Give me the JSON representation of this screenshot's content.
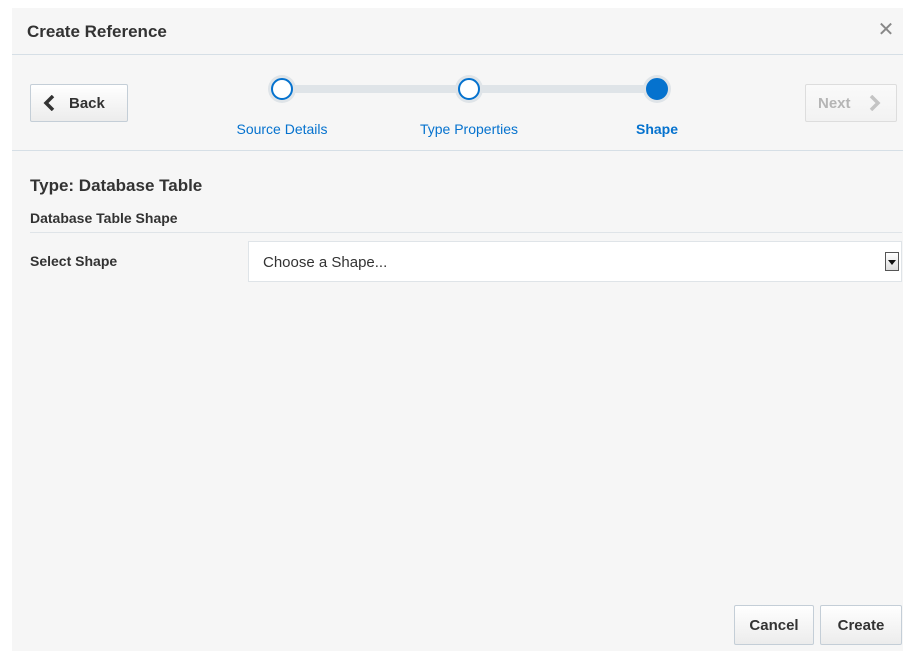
{
  "dialog": {
    "title": "Create Reference",
    "close_icon": "close-icon"
  },
  "train": {
    "back_label": "Back",
    "next_label": "Next",
    "steps": [
      {
        "label": "Source Details",
        "state": "visited"
      },
      {
        "label": "Type Properties",
        "state": "visited"
      },
      {
        "label": "Shape",
        "state": "current"
      }
    ]
  },
  "content": {
    "type_heading": "Type: Database Table",
    "section_header": "Database Table Shape",
    "select_label": "Select Shape",
    "select_value": "Choose a Shape..."
  },
  "footer": {
    "cancel_label": "Cancel",
    "create_label": "Create"
  },
  "colors": {
    "accent": "#0572ce",
    "background": "#f6f6f6",
    "border": "#d6dfe6"
  }
}
